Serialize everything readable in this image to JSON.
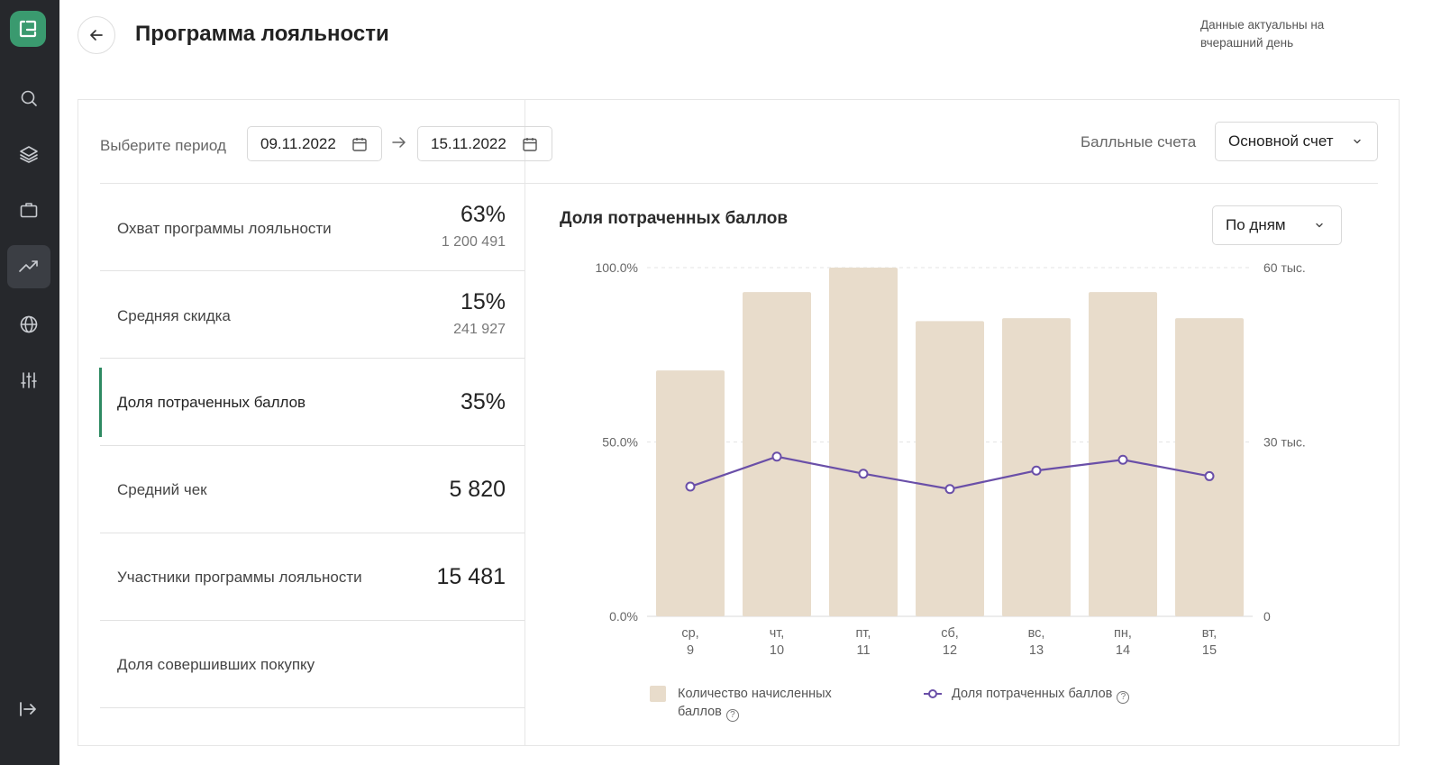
{
  "header": {
    "title": "Программа лояльности",
    "freshness_note": "Данные актуальны на вчерашний день"
  },
  "sidebar": {
    "items": [
      {
        "icon": "search-icon"
      },
      {
        "icon": "layers-icon"
      },
      {
        "icon": "briefcase-icon"
      },
      {
        "icon": "trending-up-icon",
        "active": true
      },
      {
        "icon": "globe-icon"
      },
      {
        "icon": "sliders-icon"
      }
    ]
  },
  "filters": {
    "period_label": "Выберите период",
    "date_from": "09.11.2022",
    "date_to": "15.11.2022",
    "accounts_label": "Балльные счета",
    "account_selected": "Основной счет"
  },
  "metrics": [
    {
      "label": "Охват программы лояльности",
      "value": "63%",
      "sub": "1 200 491"
    },
    {
      "label": "Средняя скидка",
      "value": "15%",
      "sub": "241 927"
    },
    {
      "label": "Доля потраченных баллов",
      "value": "35%",
      "sub": "",
      "active": true
    },
    {
      "label": "Средний чек",
      "value": "5 820",
      "sub": ""
    },
    {
      "label": "Участники программы лояльности",
      "value": "15 481",
      "sub": ""
    },
    {
      "label": "Доля совершивших покупку",
      "value": "",
      "sub": ""
    }
  ],
  "chart_panel": {
    "title": "Доля потраченных баллов",
    "grouping": "По дням",
    "legend_bars": "Количество начисленных баллов",
    "legend_line": "Доля потраченных баллов"
  },
  "colors": {
    "accent": "#2e8a62",
    "bar": "#e8dccb",
    "line": "#6a4fa8",
    "sidebar": "#26282c"
  },
  "chart_data": {
    "type": "bar",
    "categories": [
      "ср,\n9",
      "чт,\n10",
      "пт,\n11",
      "сб,\n12",
      "вс,\n13",
      "пн,\n14",
      "вт,\n15"
    ],
    "series": [
      {
        "name": "Количество начисленных баллов",
        "type": "bar",
        "axis": "right",
        "values": [
          42300,
          55800,
          60000,
          50800,
          51300,
          55800,
          51300
        ]
      },
      {
        "name": "Доля потраченных баллов",
        "type": "line",
        "axis": "left",
        "values": [
          37.2,
          45.8,
          40.9,
          36.5,
          41.8,
          44.9,
          40.2
        ]
      }
    ],
    "y_left": {
      "ticks": [
        "0.0%",
        "50.0%",
        "100.0%"
      ],
      "range": [
        0,
        100
      ]
    },
    "y_right": {
      "ticks": [
        "0",
        "30 тыс.",
        "60 тыс."
      ],
      "range": [
        0,
        60000
      ]
    },
    "grid": true,
    "legend": "bottom"
  }
}
